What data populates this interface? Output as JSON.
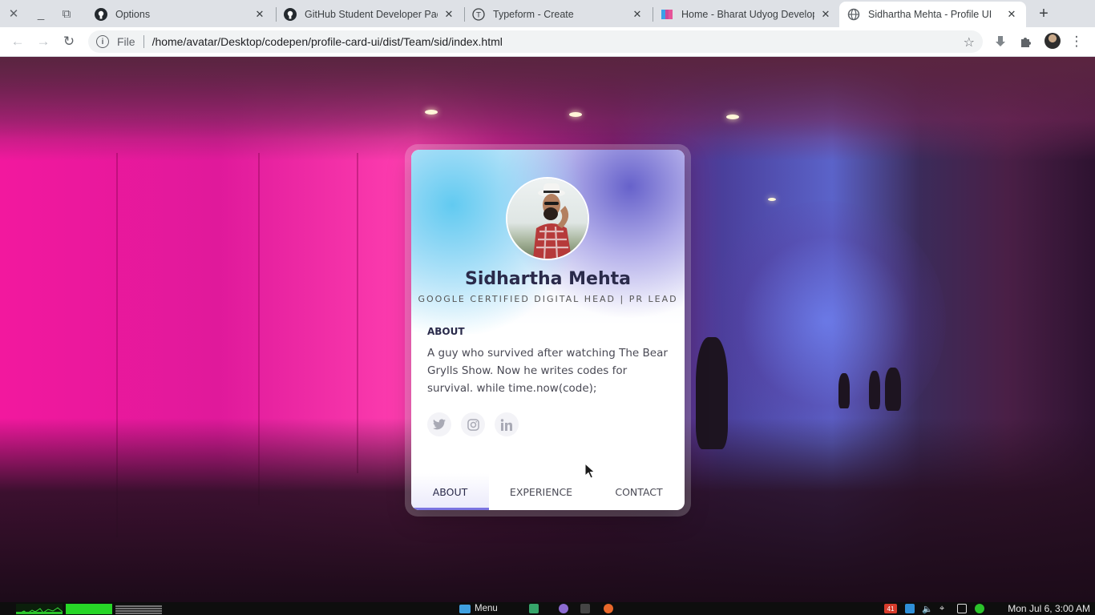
{
  "window": {
    "minimize_icon": "minimize-icon",
    "restore_icon": "restore-icon",
    "close_icon": "close-icon"
  },
  "tabs": [
    {
      "title": "Options",
      "icon": "github-icon"
    },
    {
      "title": "GitHub Student Developer Pack",
      "icon": "github-icon"
    },
    {
      "title": "Typeform - Create",
      "icon": "typeform-icon"
    },
    {
      "title": "Home - Bharat Udyog Develope",
      "icon": "bharat-udyog-icon"
    },
    {
      "title": "Sidhartha Mehta - Profile UI",
      "icon": "globe-icon",
      "active": true
    }
  ],
  "toolbar": {
    "scheme_label": "File",
    "url": "/home/avatar/Desktop/codepen/profile-card-ui/dist/Team/sid/index.html"
  },
  "profile": {
    "name": "Sidhartha Mehta",
    "role": "GOOGLE CERTIFIED DIGITAL HEAD | PR LEAD",
    "about_title": "ABOUT",
    "about_text": "A guy who survived after watching The Bear Grylls Show. Now he writes codes for survival. while time.now(code);",
    "socials": [
      "twitter-icon",
      "instagram-icon",
      "linkedin-icon"
    ],
    "tabs": [
      {
        "label": "ABOUT",
        "active": true
      },
      {
        "label": "EXPERIENCE",
        "active": false
      },
      {
        "label": "CONTACT",
        "active": false
      }
    ]
  },
  "taskbar": {
    "menu_label": "Menu",
    "clock": "Mon Jul 6, 3:00 AM",
    "battery_badge": "41"
  },
  "colors": {
    "accent": "#7a73e0",
    "name_text": "#2a2a4a",
    "tabstrip": "#dee1e6"
  }
}
